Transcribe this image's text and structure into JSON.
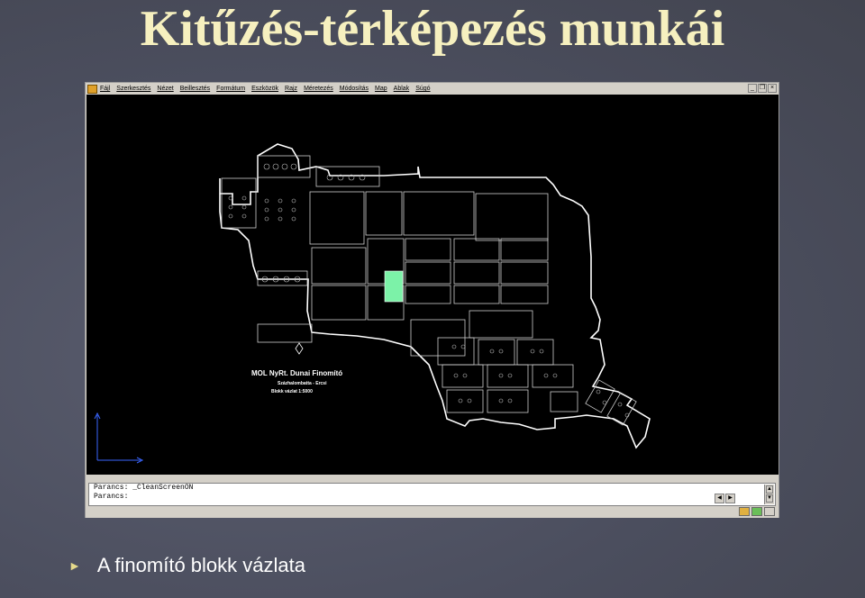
{
  "slide": {
    "title": "Kitűzés-térképezés munkái",
    "bullet_text": "A finomító blokk vázlata"
  },
  "window": {
    "menu": [
      "Fájl",
      "Szerkesztés",
      "Nézet",
      "Beillesztés",
      "Formátum",
      "Eszközök",
      "Rajz",
      "Méretezés",
      "Módosítás",
      "Map",
      "Ablak",
      "Súgó"
    ]
  },
  "drawing": {
    "map_title": "MOL NyRt. Dunai Finomító",
    "map_location": "Százhalombatta - Ercsi",
    "map_scale": "Blokk vázlat 1:5000",
    "highlight_color": "#7cf2a8",
    "outline_color": "#ffffff"
  },
  "command": {
    "line1": "Parancs: _CleanScreenON",
    "line2": "Parancs:"
  },
  "colors": {
    "title": "#f6f0bf",
    "background": "#4b4e5e"
  }
}
